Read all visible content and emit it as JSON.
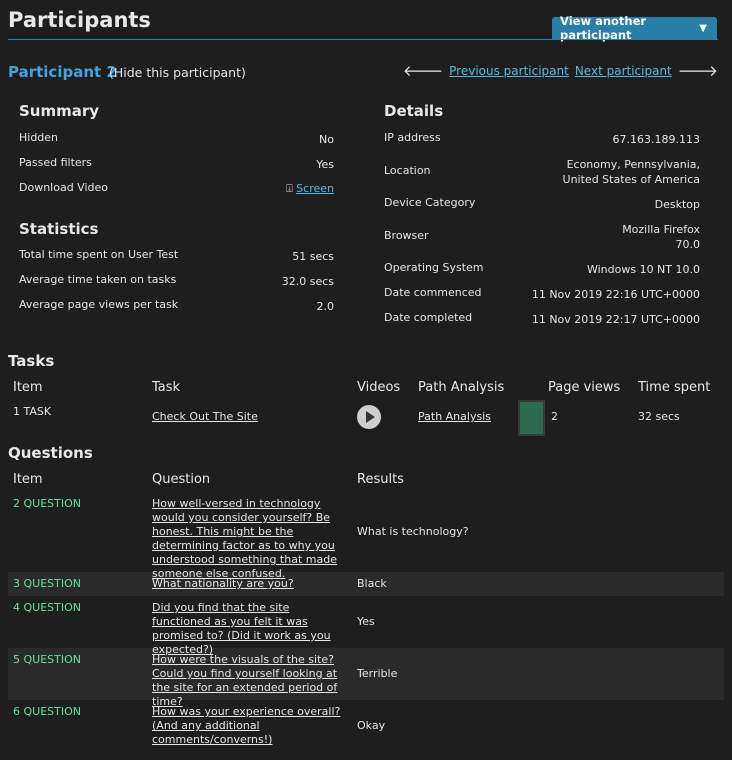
{
  "header": {
    "title": "Participants",
    "view_another": "View another participant"
  },
  "participant": {
    "name": "Participant 2",
    "hide": "(Hide this participant)",
    "prev": "Previous participant",
    "next": "Next participant"
  },
  "summary": {
    "title": "Summary",
    "rows": [
      {
        "label": "Hidden",
        "value": "No"
      },
      {
        "label": "Passed filters",
        "value": "Yes"
      },
      {
        "label": "Download Video",
        "value": "Screen"
      }
    ]
  },
  "statistics": {
    "title": "Statistics",
    "rows": [
      {
        "label": "Total time spent on User Test",
        "value": "51 secs"
      },
      {
        "label": "Average time taken on tasks",
        "value": "32.0 secs"
      },
      {
        "label": "Average page views per task",
        "value": "2.0"
      }
    ]
  },
  "details": {
    "title": "Details",
    "rows": [
      {
        "label": "IP address",
        "value": "67.163.189.113"
      },
      {
        "label": "Location",
        "value": "Economy, Pennsylvania, United States of America"
      },
      {
        "label": "Device Category",
        "value": "Desktop"
      },
      {
        "label": "Browser",
        "value": "Mozilla Firefox 70.0"
      },
      {
        "label": "Operating System",
        "value": "Windows 10 NT 10.0"
      },
      {
        "label": "Date commenced",
        "value": "11 Nov 2019 22:16 UTC+0000"
      },
      {
        "label": "Date completed",
        "value": "11 Nov 2019 22:17 UTC+0000"
      }
    ]
  },
  "tasks": {
    "title": "Tasks",
    "headers": [
      "Item",
      "Task",
      "Videos",
      "Path Analysis",
      "Page views",
      "Time spent"
    ],
    "rows": [
      {
        "item": "1 TASK",
        "task": "Check Out The Site",
        "path": "Path Analysis",
        "views": "2",
        "time": "32 secs",
        "color": "#2d6b4f"
      }
    ]
  },
  "questions": {
    "title": "Questions",
    "headers": [
      "Item",
      "Question",
      "Results"
    ],
    "rows": [
      {
        "item": "2 QUESTION",
        "question": "How well-versed in technology would you consider yourself? Be honest. This might be the determining factor as to why you understood something that made someone else confused.",
        "result": "What is technology?"
      },
      {
        "item": "3 QUESTION",
        "question": "What nationality are you?",
        "result": "Black"
      },
      {
        "item": "4 QUESTION",
        "question": "Did you find that the site functioned as you felt it was promised to? (Did it work as you expected?)",
        "result": "Yes"
      },
      {
        "item": "5 QUESTION",
        "question": "How were the visuals of the site? Could you find yourself looking at the site for an extended period of time?",
        "result": "Terrible"
      },
      {
        "item": "6 QUESTION",
        "question": "How was your experience overall? (And any additional comments/converns!)",
        "result": "Okay"
      }
    ]
  },
  "colors": {
    "accent": "#2a7fa8",
    "link": "#5ab8e6",
    "question_id": "#5ee49a",
    "background": "#1e1e1e"
  }
}
